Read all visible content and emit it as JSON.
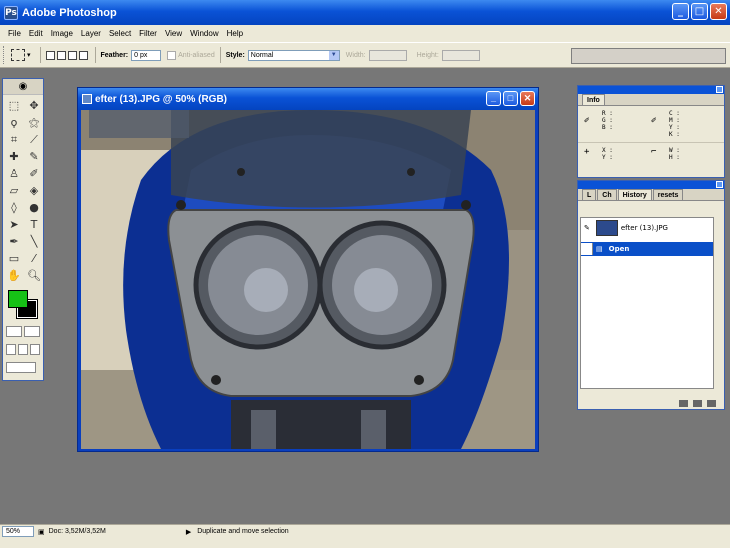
{
  "app": {
    "title": "Adobe Photoshop"
  },
  "menu": [
    "File",
    "Edit",
    "Image",
    "Layer",
    "Select",
    "Filter",
    "View",
    "Window",
    "Help"
  ],
  "options": {
    "feather_label": "Feather:",
    "feather_value": "0 px",
    "antialiased_label": "Anti-aliased",
    "style_label": "Style:",
    "style_value": "Normal",
    "width_label": "Width:",
    "height_label": "Height:"
  },
  "document": {
    "title": "efter (13).JPG @ 50% (RGB)"
  },
  "info_palette": {
    "tab": "Info",
    "rgb": "R :\nG :\nB :",
    "cmyk": "C :\nM :\nY :\nK :",
    "xy": "X :\nY :",
    "wh": "W :\nH :"
  },
  "history_palette": {
    "tabs": [
      "L",
      "Ch",
      "History",
      "resets"
    ],
    "snapshot": "efter (13).JPG",
    "step": "Open"
  },
  "status": {
    "zoom": "50%",
    "doc": "Doc: 3,52M/3,52M",
    "hint": "Duplicate and move selection"
  },
  "colors": {
    "foreground": "#16c116",
    "background": "#000000",
    "accent": "#0a52d6"
  }
}
